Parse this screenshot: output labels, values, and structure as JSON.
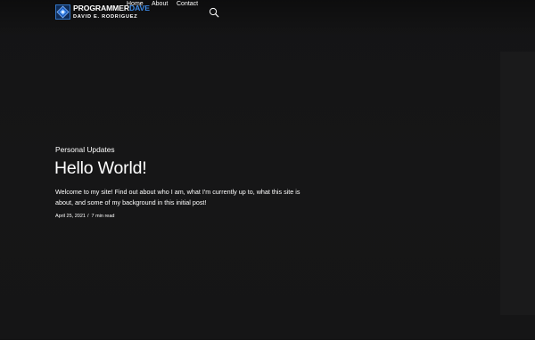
{
  "header": {
    "logo": {
      "line1_part1": "PROGRAMMER",
      "line1_part2": "DAVE",
      "line2": "DAVID E. RODRIGUEZ",
      "icon": "diamond-logo-icon"
    },
    "nav": [
      {
        "label": "Home"
      },
      {
        "label": "About"
      },
      {
        "label": "Contact"
      }
    ],
    "search_icon": "search-icon"
  },
  "post": {
    "category": "Personal Updates",
    "title": "Hello World!",
    "excerpt": "Welcome to my site! Find out about who I am, what I'm currently up to, what this site is about, and some of my background in this initial post!",
    "date": "April 25, 2021",
    "separator": "/",
    "read_time": "7 min read"
  },
  "colors": {
    "background": "#161617",
    "text": "#ffffff",
    "brand_blue": "#3d8be8"
  }
}
